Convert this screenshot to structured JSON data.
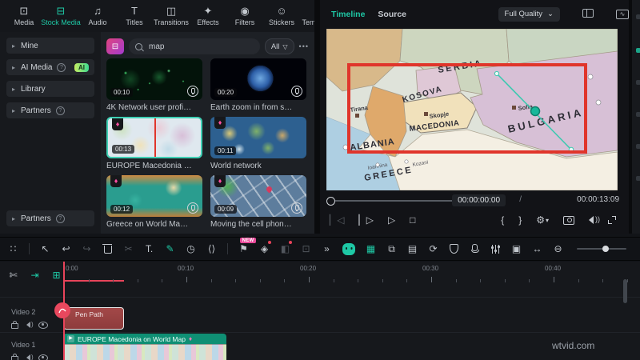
{
  "top_nav": {
    "items": [
      {
        "name": "nav-media",
        "label": "Media",
        "glyph": "⊡"
      },
      {
        "name": "nav-stock-media",
        "label": "Stock Media",
        "glyph": "⊟",
        "active": true
      },
      {
        "name": "nav-audio",
        "label": "Audio",
        "glyph": "♫"
      },
      {
        "name": "nav-titles",
        "label": "Titles",
        "glyph": "T"
      },
      {
        "name": "nav-transitions",
        "label": "Transitions",
        "glyph": "◫"
      },
      {
        "name": "nav-effects",
        "label": "Effects",
        "glyph": "✦"
      },
      {
        "name": "nav-filters",
        "label": "Filters",
        "glyph": "◉"
      },
      {
        "name": "nav-stickers",
        "label": "Stickers",
        "glyph": "☺"
      },
      {
        "name": "nav-templates",
        "label": "Templates",
        "glyph": "⊞"
      }
    ]
  },
  "sidebar": {
    "items": [
      {
        "name": "sidebar-item-mine",
        "label": "Mine"
      },
      {
        "name": "sidebar-item-ai-media",
        "label": "AI Media",
        "help": "?",
        "badge": "AI"
      },
      {
        "name": "sidebar-item-library",
        "label": "Library"
      },
      {
        "name": "sidebar-item-partners",
        "label": "Partners",
        "help": "?"
      }
    ],
    "bottom": {
      "label": "Partners",
      "help": "?"
    },
    "chevron": "▸"
  },
  "stock": {
    "search_value": "map",
    "filter_label": "All",
    "funnel_glyph": "▽",
    "more_glyph": "•••",
    "emblem_glyph": "⊟",
    "cards": [
      {
        "title": "4K Network user profi…",
        "duration": "00:10",
        "art": "art-net",
        "mic": true
      },
      {
        "title": "Earth zoom in from s…",
        "duration": "00:20",
        "art": "art-earth",
        "mic": true
      },
      {
        "title": "EUROPE Macedonia …",
        "duration": "00:13",
        "art": "art-europe",
        "premium": "♦",
        "selected": true
      },
      {
        "title": "World network",
        "duration": "00:11",
        "art": "art-world",
        "premium": "♦"
      },
      {
        "title": "Greece on World Ma…",
        "duration": "00:12",
        "art": "art-greece",
        "premium": "♦",
        "mic": true
      },
      {
        "title": "Moving the cell phon…",
        "duration": "00:09",
        "art": "art-city",
        "premium": "♦",
        "mic": true
      },
      {
        "art": "art-cut1",
        "premium": "♦",
        "partial": true
      },
      {
        "art": "art-cut2",
        "premium": "♦",
        "partial": true
      }
    ]
  },
  "preview": {
    "tabs": [
      {
        "name": "tab-timeline",
        "label": "Timeline",
        "active": true
      },
      {
        "name": "tab-source",
        "label": "Source"
      }
    ],
    "quality_label": "Full Quality",
    "quality_caret": "⌄",
    "scope_glyph": "∿",
    "current_time": "00:00:00:00",
    "time_sep": "/",
    "total_time": "00:00:13:09",
    "map": {
      "serbia": "SERBIA",
      "kosova": "KOSOVA",
      "macedonia": "MACEDONIA",
      "albania": "ALBANIA",
      "bulgaria": "BULGARIA",
      "greece": "GREECE",
      "tirana": "Tirana",
      "skopje": "Skopje",
      "sofia": "Sofia",
      "kozani": "Kozani",
      "ioannina": "Ioannina"
    },
    "controls_left": [
      {
        "name": "prev-frame-button",
        "glyph": "▏◁",
        "dim": true
      },
      {
        "name": "next-frame-button",
        "glyph": "▏▷"
      },
      {
        "name": "play-button",
        "glyph": "▷"
      },
      {
        "name": "stop-button",
        "glyph": "□"
      }
    ],
    "controls_right": [
      {
        "name": "mark-in-button",
        "glyph": "{"
      },
      {
        "name": "mark-out-button",
        "glyph": "}"
      },
      {
        "name": "render-settings-button",
        "glyph": "⚙",
        "sub": "▾"
      },
      {
        "name": "snapshot-button",
        "css": "ic-cam"
      },
      {
        "name": "volume-button",
        "css": "ic-vol"
      },
      {
        "name": "fullscreen-button",
        "css": "ic-fs"
      }
    ]
  },
  "tools": {
    "left": [
      {
        "name": "layout-grid-icon",
        "glyph": "∷"
      },
      {
        "divider": true
      },
      {
        "name": "select-tool-icon",
        "glyph": "↖"
      },
      {
        "name": "undo-icon",
        "glyph": "↩"
      },
      {
        "name": "redo-icon",
        "glyph": "↪",
        "disabled": true
      },
      {
        "name": "delete-icon",
        "css": "ic-trash"
      },
      {
        "name": "split-icon",
        "glyph": "✂",
        "disabled": true
      },
      {
        "name": "text-tool-icon",
        "glyph": "T."
      },
      {
        "name": "pen-tool-icon",
        "glyph": "✎",
        "active": true
      },
      {
        "name": "timer-icon",
        "glyph": "◷"
      },
      {
        "name": "speed-icon",
        "glyph": "⟨⟩"
      },
      {
        "divider": true
      },
      {
        "name": "keyframe-icon",
        "glyph": "⚑",
        "badge": "NEW"
      },
      {
        "name": "ai-audio-icon",
        "glyph": "◈",
        "dot": true
      },
      {
        "name": "mask-icon",
        "glyph": "◧",
        "disabled": true,
        "dot": true
      },
      {
        "name": "plugin-icon",
        "glyph": "⊡",
        "disabled": true
      },
      {
        "name": "more-tools-icon",
        "glyph": "»"
      }
    ],
    "right": [
      {
        "name": "ai-assistant-icon",
        "css": "ic-robot"
      },
      {
        "name": "ai-chip-icon",
        "glyph": "▦",
        "teal": true
      },
      {
        "name": "export-clip-icon",
        "glyph": "⧉"
      },
      {
        "name": "export-frame-icon",
        "glyph": "▤"
      },
      {
        "name": "loop-record-icon",
        "glyph": "⟳"
      },
      {
        "name": "shield-icon",
        "css": "ic-shield"
      },
      {
        "name": "mic-icon",
        "css": "ic-mic"
      },
      {
        "name": "mixer-icon",
        "css": "ic-mixer"
      },
      {
        "name": "device-settings-icon",
        "glyph": "▣"
      },
      {
        "name": "fit-timeline-icon",
        "glyph": "↔"
      },
      {
        "name": "zoom-out-icon",
        "glyph": "⊖"
      },
      {
        "name": "zoom-slider",
        "css": "ic-hslider"
      },
      {
        "name": "zoom-in-icon",
        "glyph": "⊕"
      },
      {
        "name": "track-manager-icon",
        "css": "ic-tracklist"
      },
      {
        "name": "track-manager-caret",
        "glyph": "▾"
      }
    ]
  },
  "timeline": {
    "header_icons": [
      {
        "name": "snap-icon",
        "glyph": "✄"
      },
      {
        "name": "auto-ripple-icon",
        "glyph": "⇥",
        "teal": true
      },
      {
        "name": "link-icon",
        "glyph": "⊞",
        "teal": true
      }
    ],
    "ruler_labels": [
      "0:00",
      "00:10",
      "00:20",
      "00:30",
      "00:40"
    ],
    "tracks": [
      {
        "name": "Video 2"
      },
      {
        "name": "Video 1"
      }
    ],
    "clips": {
      "pen": {
        "label": "Pen Path",
        "icon_glyph": "✎"
      },
      "video": {
        "label": "EUROPE Macedonia on World Map",
        "gem": "♦",
        "play_glyph": "▶"
      }
    }
  },
  "watermark": "wtvid.com"
}
